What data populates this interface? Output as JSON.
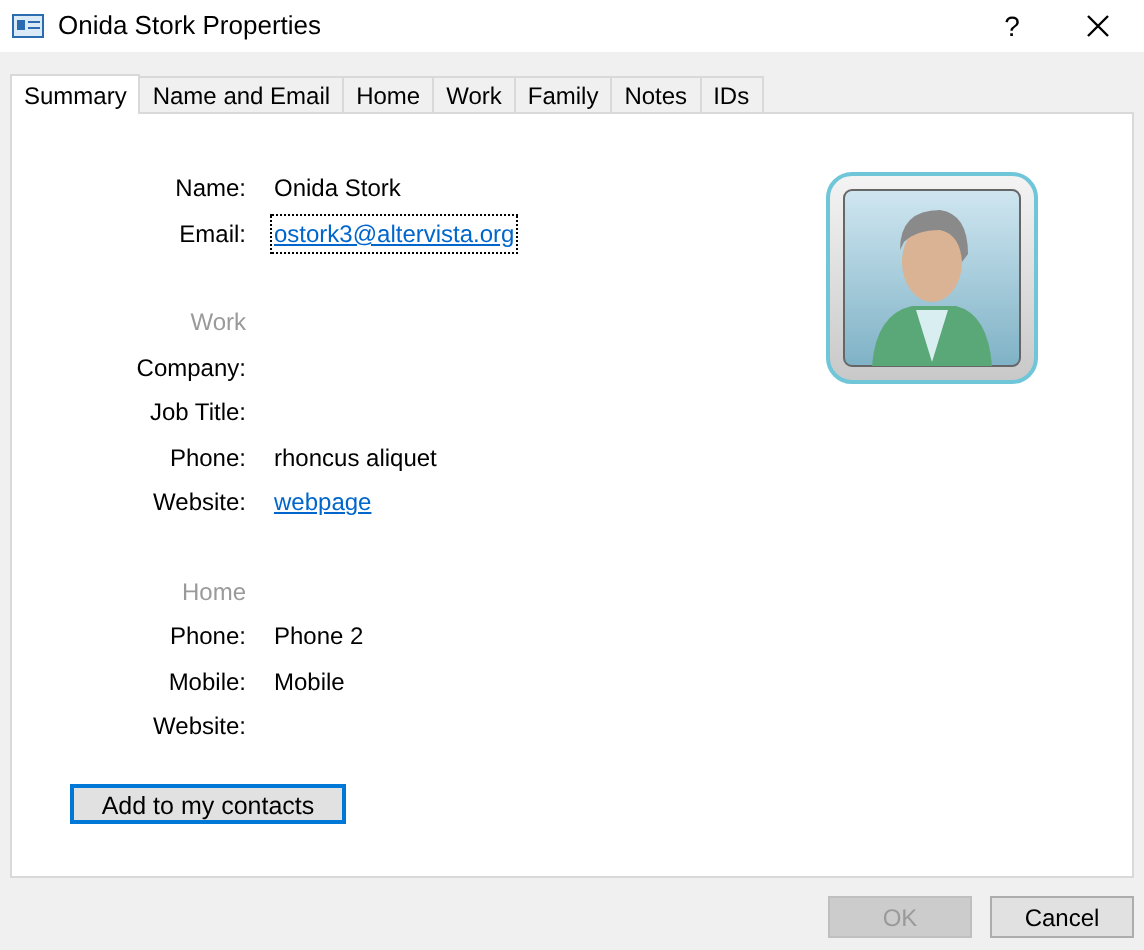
{
  "window": {
    "title": "Onida Stork Properties",
    "help": "?"
  },
  "tabs": [
    {
      "label": "Summary",
      "selected": true
    },
    {
      "label": "Name and Email",
      "selected": false
    },
    {
      "label": "Home",
      "selected": false
    },
    {
      "label": "Work",
      "selected": false
    },
    {
      "label": "Family",
      "selected": false
    },
    {
      "label": "Notes",
      "selected": false
    },
    {
      "label": "IDs",
      "selected": false
    }
  ],
  "sections": [
    {
      "rows": [
        {
          "label": "Name:",
          "value": "Onida Stork",
          "kind": "text"
        },
        {
          "label": "Email:",
          "value": "ostork3@altervista.org",
          "kind": "link",
          "focused": true
        }
      ]
    },
    {
      "heading": "Work",
      "rows": [
        {
          "label": "Company:"
        },
        {
          "label": "Job Title:"
        },
        {
          "label": "Phone:",
          "value": "rhoncus aliquet",
          "kind": "text"
        },
        {
          "label": "Website:",
          "value": "webpage",
          "kind": "link",
          "focused": false
        }
      ]
    },
    {
      "heading": "Home",
      "rows": [
        {
          "label": "Phone:",
          "value": "Phone 2",
          "kind": "text"
        },
        {
          "label": "Mobile:",
          "value": "Mobile",
          "kind": "text"
        },
        {
          "label": "Website:"
        }
      ]
    }
  ],
  "add_button": "Add to my contacts",
  "buttons": [
    {
      "label": "OK",
      "disabled": true
    },
    {
      "label": "Cancel",
      "disabled": false
    }
  ]
}
